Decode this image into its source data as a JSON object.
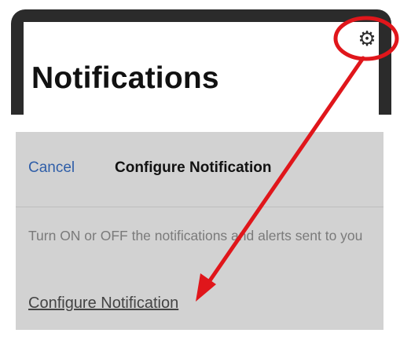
{
  "top": {
    "title": "Notifications",
    "gear_icon": "gear-icon"
  },
  "panel": {
    "cancel_label": "Cancel",
    "title": "Configure Notification",
    "description": "Turn ON or OFF the notifications and alerts sent to you",
    "link_label": "Configure Notification"
  },
  "colors": {
    "annotation_red": "#e0161b",
    "cancel_blue": "#2f5ea8",
    "panel_gray": "#d2d2d2",
    "frame_dark": "#2b2b2b"
  }
}
